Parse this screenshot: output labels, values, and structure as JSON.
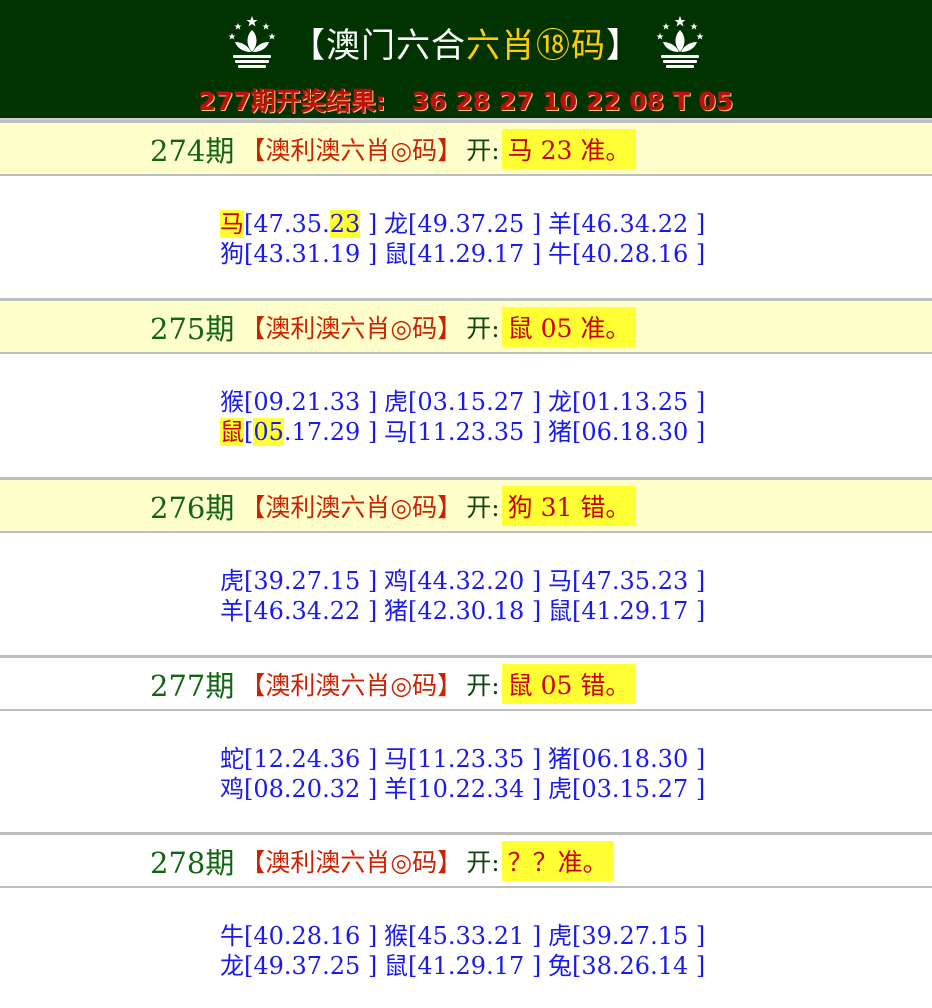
{
  "header": {
    "title_open": "【",
    "title_main": "澳门六合",
    "title_hl": "六肖⑱码",
    "title_close": "】",
    "result_text": "277期开奖结果:   36 28 27 10 22 08 T 05"
  },
  "colors": {
    "header_bg": "#003300",
    "period_bg": "#ffffcc",
    "zodiac_blue": "#1a1aee",
    "highlight": "#ffff33",
    "period_green": "#116611"
  },
  "periods": [
    {
      "label": "274期",
      "brand": "【澳利澳六肖◎码】",
      "kai": "开:",
      "pick": "马 23 准。",
      "rows": [
        [
          {
            "z": "马",
            "pre": "[47.35.",
            "hit": "23",
            "post": " ]",
            "hitz": true
          },
          {
            "z": "龙",
            "n": "[49.37.25 ]"
          },
          {
            "z": "羊",
            "n": "[46.34.22 ]"
          }
        ],
        [
          {
            "z": "狗",
            "n": "[43.31.19 ]"
          },
          {
            "z": "鼠",
            "n": "[41.29.17 ]"
          },
          {
            "z": "牛",
            "n": "[40.28.16 ]"
          }
        ]
      ]
    },
    {
      "label": "275期",
      "brand": "【澳利澳六肖◎码】",
      "kai": "开:",
      "pick": "鼠 05 准。",
      "rows": [
        [
          {
            "z": "猴",
            "n": "[09.21.33 ]"
          },
          {
            "z": "虎",
            "n": "[03.15.27 ]"
          },
          {
            "z": "龙",
            "n": "[01.13.25 ]"
          }
        ],
        [
          {
            "z": "鼠",
            "pre": "[",
            "hit": "05",
            "post": ".17.29 ]",
            "hitz": true
          },
          {
            "z": "马",
            "n": "[11.23.35 ]"
          },
          {
            "z": "猪",
            "n": "[06.18.30 ]"
          }
        ]
      ]
    },
    {
      "label": "276期",
      "brand": "【澳利澳六肖◎码】",
      "kai": "开:",
      "pick": "狗 31 错。",
      "rows": [
        [
          {
            "z": "虎",
            "n": "[39.27.15 ]"
          },
          {
            "z": "鸡",
            "n": "[44.32.20 ]"
          },
          {
            "z": "马",
            "n": "[47.35.23 ]"
          }
        ],
        [
          {
            "z": "羊",
            "n": "[46.34.22 ]"
          },
          {
            "z": "猪",
            "n": "[42.30.18 ]"
          },
          {
            "z": "鼠",
            "n": "[41.29.17 ]"
          }
        ]
      ]
    },
    {
      "label": "277期",
      "brand": "【澳利澳六肖◎码】",
      "kai": "开:",
      "pick": "鼠 05 错。",
      "rows": [
        [
          {
            "z": "蛇",
            "n": "[12.24.36 ]"
          },
          {
            "z": "马",
            "n": "[11.23.35 ]"
          },
          {
            "z": "猪",
            "n": "[06.18.30 ]"
          }
        ],
        [
          {
            "z": "鸡",
            "n": "[08.20.32 ]"
          },
          {
            "z": "羊",
            "n": "[10.22.34 ]"
          },
          {
            "z": "虎",
            "n": "[03.15.27 ]"
          }
        ]
      ]
    },
    {
      "label": "278期",
      "brand": "【澳利澳六肖◎码】",
      "kai": "开:",
      "pick": "？？准。",
      "rows": [
        [
          {
            "z": "牛",
            "n": "[40.28.16 ]"
          },
          {
            "z": "猴",
            "n": "[45.33.21 ]"
          },
          {
            "z": "虎",
            "n": "[39.27.15 ]"
          }
        ],
        [
          {
            "z": "龙",
            "n": "[49.37.25 ]"
          },
          {
            "z": "鼠",
            "n": "[41.29.17 ]"
          },
          {
            "z": "兔",
            "n": "[38.26.14 ]"
          }
        ]
      ]
    }
  ]
}
